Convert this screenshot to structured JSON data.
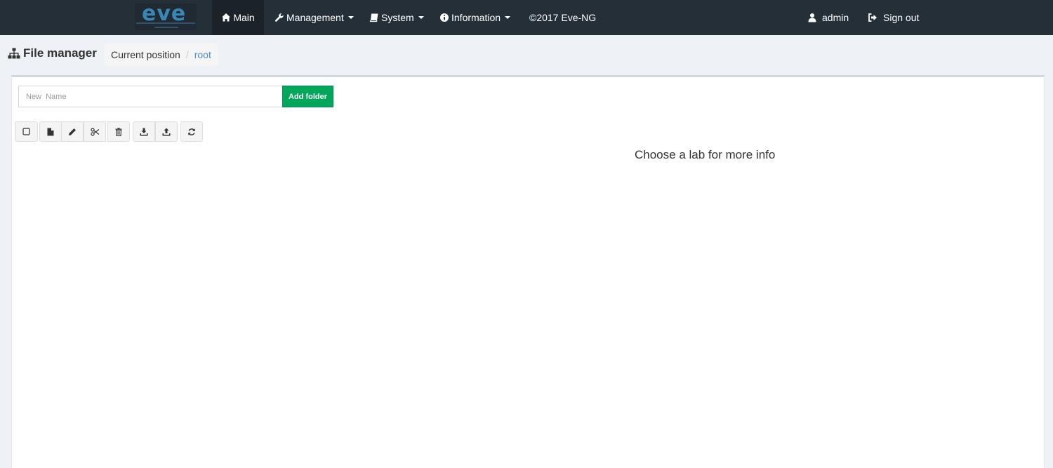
{
  "navbar": {
    "logo_text": "eve",
    "items": [
      {
        "label": "Main",
        "icon": "home-icon"
      },
      {
        "label": "Management",
        "icon": "wrench-icon"
      },
      {
        "label": "System",
        "icon": "book-icon"
      },
      {
        "label": "Information",
        "icon": "info-circle-icon"
      },
      {
        "label": "©2017 Eve-NG"
      }
    ],
    "user_label": "admin",
    "signout_label": "Sign out"
  },
  "header": {
    "title": "File manager",
    "title_icon": "sitemap-icon",
    "breadcrumb": [
      "Current position",
      "root"
    ]
  },
  "folder_form": {
    "placeholder": "New  Name",
    "value": "",
    "add_label": "Add folder"
  },
  "toolbar": {
    "buttons": [
      "checkbox-icon",
      "new-file-icon",
      "pencil-icon",
      "scissors-icon",
      "trash-icon",
      "download-icon",
      "upload-icon",
      "refresh-icon"
    ]
  },
  "info": {
    "text": "Choose a lab for more info"
  },
  "colors": {
    "navbar": "#242f37",
    "accent_green": "#00a65a",
    "link_blue": "#4a8cc8"
  }
}
